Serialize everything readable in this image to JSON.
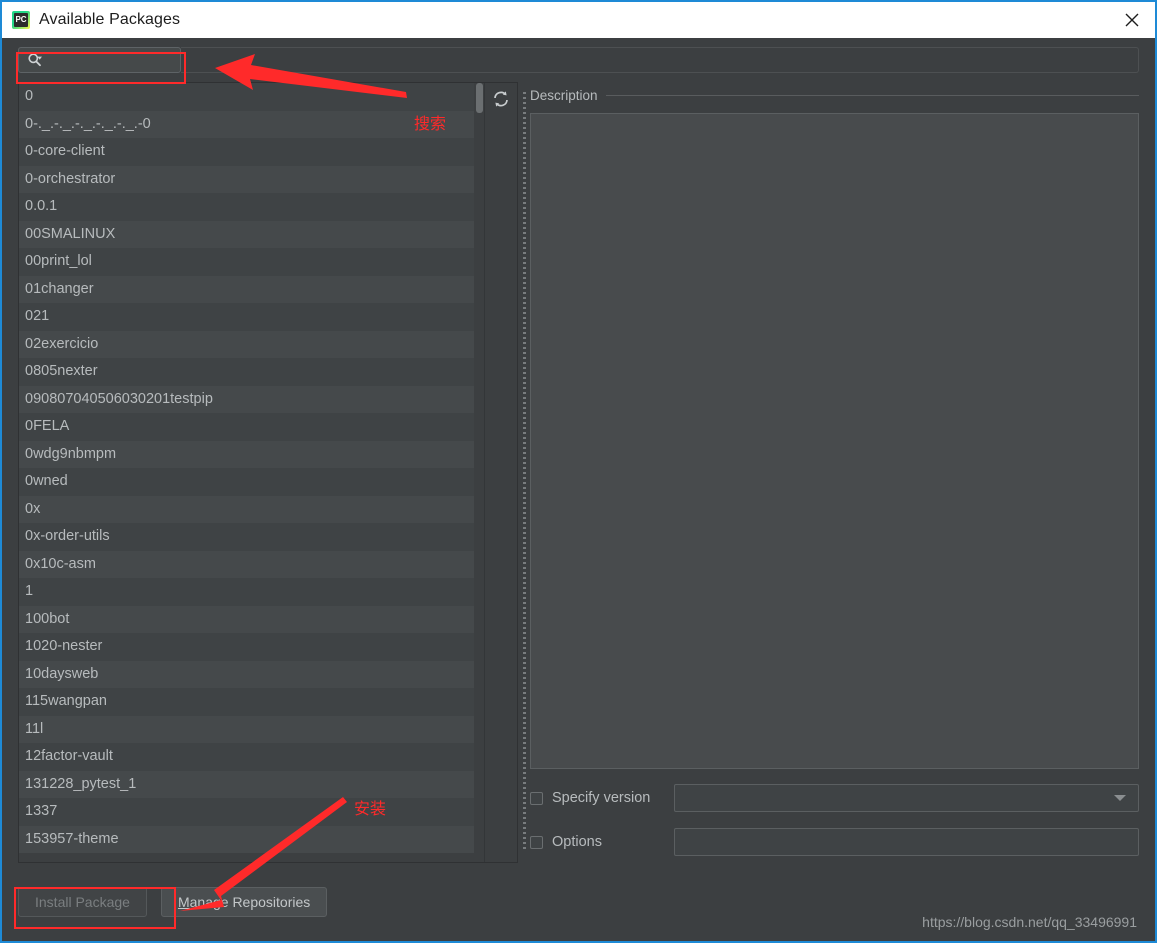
{
  "window": {
    "title": "Available Packages",
    "icon": "pycharm-icon",
    "close_icon": "close-icon",
    "border_color": "#1e8ad6"
  },
  "search": {
    "value": "",
    "placeholder": "",
    "icon": "search-icon",
    "dropdown_icon": "chevron-down-icon"
  },
  "toolbar": {
    "reload_icon": "refresh-icon"
  },
  "packages": [
    "0",
    "0-._.-._.-._.-._.-._.-0",
    "0-core-client",
    "0-orchestrator",
    "0.0.1",
    "00SMALINUX",
    "00print_lol",
    "01changer",
    "021",
    "02exercicio",
    "0805nexter",
    "090807040506030201testpip",
    "0FELA",
    "0wdg9nbmpm",
    "0wned",
    "0x",
    "0x-order-utils",
    "0x10c-asm",
    "1",
    "100bot",
    "1020-nester",
    "10daysweb",
    "115wangpan",
    "11l",
    "12factor-vault",
    "131228_pytest_1",
    "1337",
    "153957-theme"
  ],
  "description": {
    "legend": "Description",
    "body": ""
  },
  "options": {
    "specify_version": {
      "label": "Specify version",
      "checked": false,
      "value": ""
    },
    "options": {
      "label": "Options",
      "checked": false,
      "value": ""
    }
  },
  "footer": {
    "install_button": "Install Package",
    "install_disabled": true,
    "manage_button_mnemonic": "M",
    "manage_button_rest": "anage Repositories",
    "watermark": "https://blog.csdn.net/qq_33496991"
  },
  "annotations": {
    "search_label": "搜索",
    "install_label": "安装",
    "color": "#ff2a2a"
  }
}
